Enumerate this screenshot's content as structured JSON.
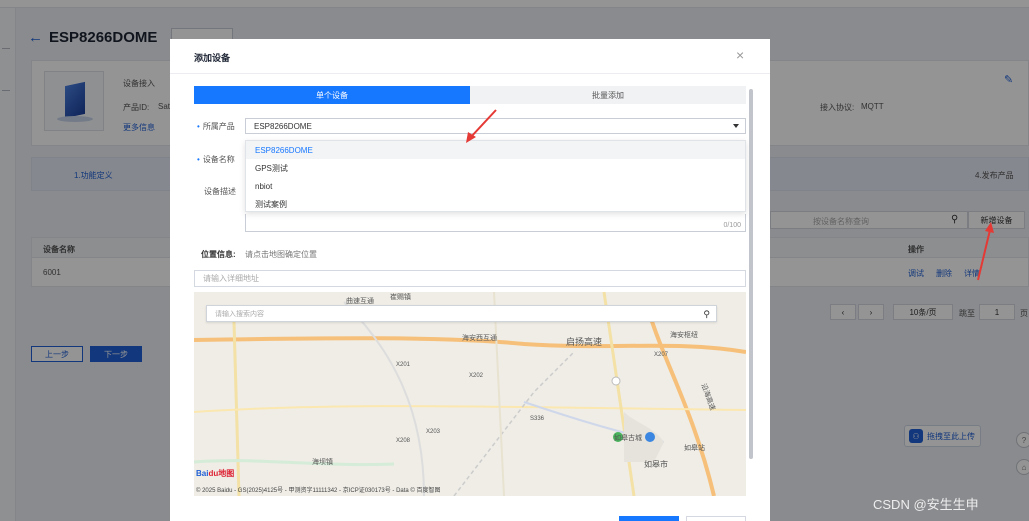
{
  "background": {
    "page_title": "ESP8266DOME",
    "info": {
      "access_label": "设备接入",
      "product_id_label": "产品ID:",
      "product_id_value": "Sat2",
      "more_info": "更多信息",
      "protocol_label": "接入协议:",
      "protocol_value": "MQTT"
    },
    "steps": {
      "step1": "1.功能定义",
      "step4": "4.发布产品"
    },
    "search_placeholder": "按设备名称查询",
    "add_device_button": "新增设备",
    "table": {
      "col_name": "设备名称",
      "col_ops": "操作",
      "row_name": "6001",
      "op_debug": "调试",
      "op_delete": "删除",
      "op_detail": "详情"
    },
    "pager": {
      "page_size": "10条/页",
      "goto_label": "跳至",
      "page_value": "1",
      "page_suffix": "页"
    },
    "prev_button": "上一步",
    "next_button": "下一步",
    "float_button": "拖拽至此上传"
  },
  "modal": {
    "title": "添加设备",
    "tabs": [
      "单个设备",
      "批量添加"
    ],
    "product_label": "所属产品",
    "product_value": "ESP8266DOME",
    "device_name_label": "设备名称",
    "device_desc_label": "设备描述",
    "desc_counter": "0/100",
    "dropdown_options": [
      "ESP8266DOME",
      "GPS测试",
      "nbiot",
      "测试案例"
    ],
    "location_label": "位置信息:",
    "location_hint": "请点击地图确定位置",
    "address_placeholder": "请输入详细地址",
    "map_search_placeholder": "请输入搜索内容",
    "map_labels": [
      "曲速互通",
      "崔赐镇",
      "海安西互通",
      "启扬高速",
      "海安枢纽",
      "X207",
      "X201",
      "X208",
      "X203",
      "X202",
      "S336",
      "如皋古城",
      "如皋站",
      "如皋市",
      "海坝镇",
      "沿海高速"
    ],
    "map_copyright": "© 2025 Baidu - GS(2025)4125号 - 甲测资字11111342 - 京ICP证030173号 - Data © 百度智图",
    "map_logo_a": "Bai",
    "map_logo_b": "du地图"
  },
  "watermark": "CSDN @安生生申",
  "colors": {
    "accent": "#1677ff",
    "overlay": "rgba(0,0,0,0.42)",
    "arrow": "#e53935"
  }
}
